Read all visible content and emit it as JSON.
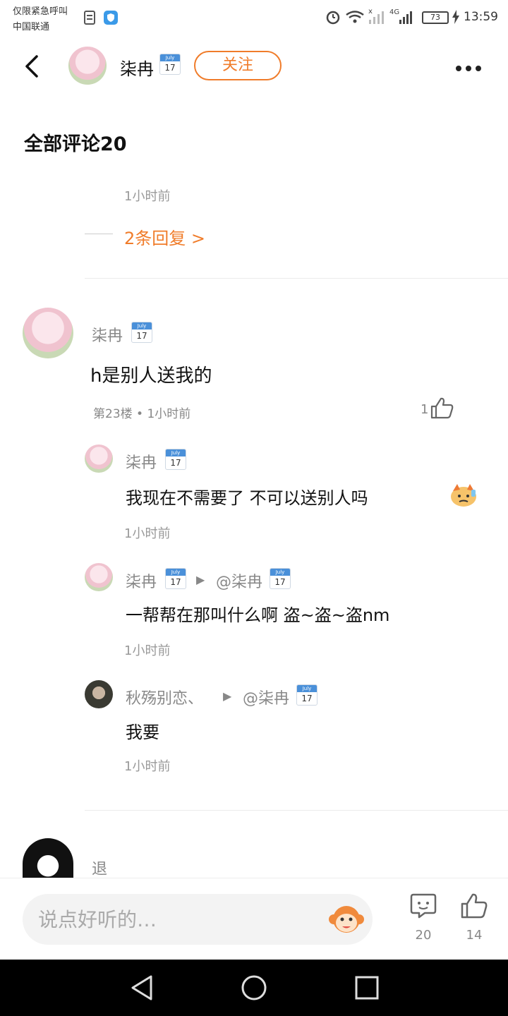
{
  "status_bar": {
    "carrier_line1": "仅限紧急呼叫",
    "carrier_line2": "中国联通",
    "battery": "73",
    "time": "13:59"
  },
  "header": {
    "username": "柒冉",
    "calendar_month": "July",
    "calendar_day": "17",
    "follow_label": "关注"
  },
  "section_title": "全部评论20",
  "prev_comment": {
    "time": "1小时前",
    "replies_link": "2条回复 >"
  },
  "comment": {
    "username": "柒冉",
    "content": "h是别人送我的",
    "floor_meta": "第23楼 • 1小时前",
    "likes": "1"
  },
  "replies": [
    {
      "username": "柒冉",
      "content": "我现在不需要了 不可以送别人吗",
      "time": "1小时前"
    },
    {
      "username": "柒冉",
      "reply_to": "@柒冉",
      "content": "一帮帮在那叫什么啊 盗~盗~盗nm",
      "time": "1小时前"
    },
    {
      "username": "秋殇别恋、",
      "reply_to": "@柒冉",
      "content": "我要",
      "time": "1小时前"
    }
  ],
  "next_comment": {
    "username": "退"
  },
  "bottom_bar": {
    "input_placeholder": "说点好听的…",
    "comments_count": "20",
    "likes_count": "14"
  }
}
